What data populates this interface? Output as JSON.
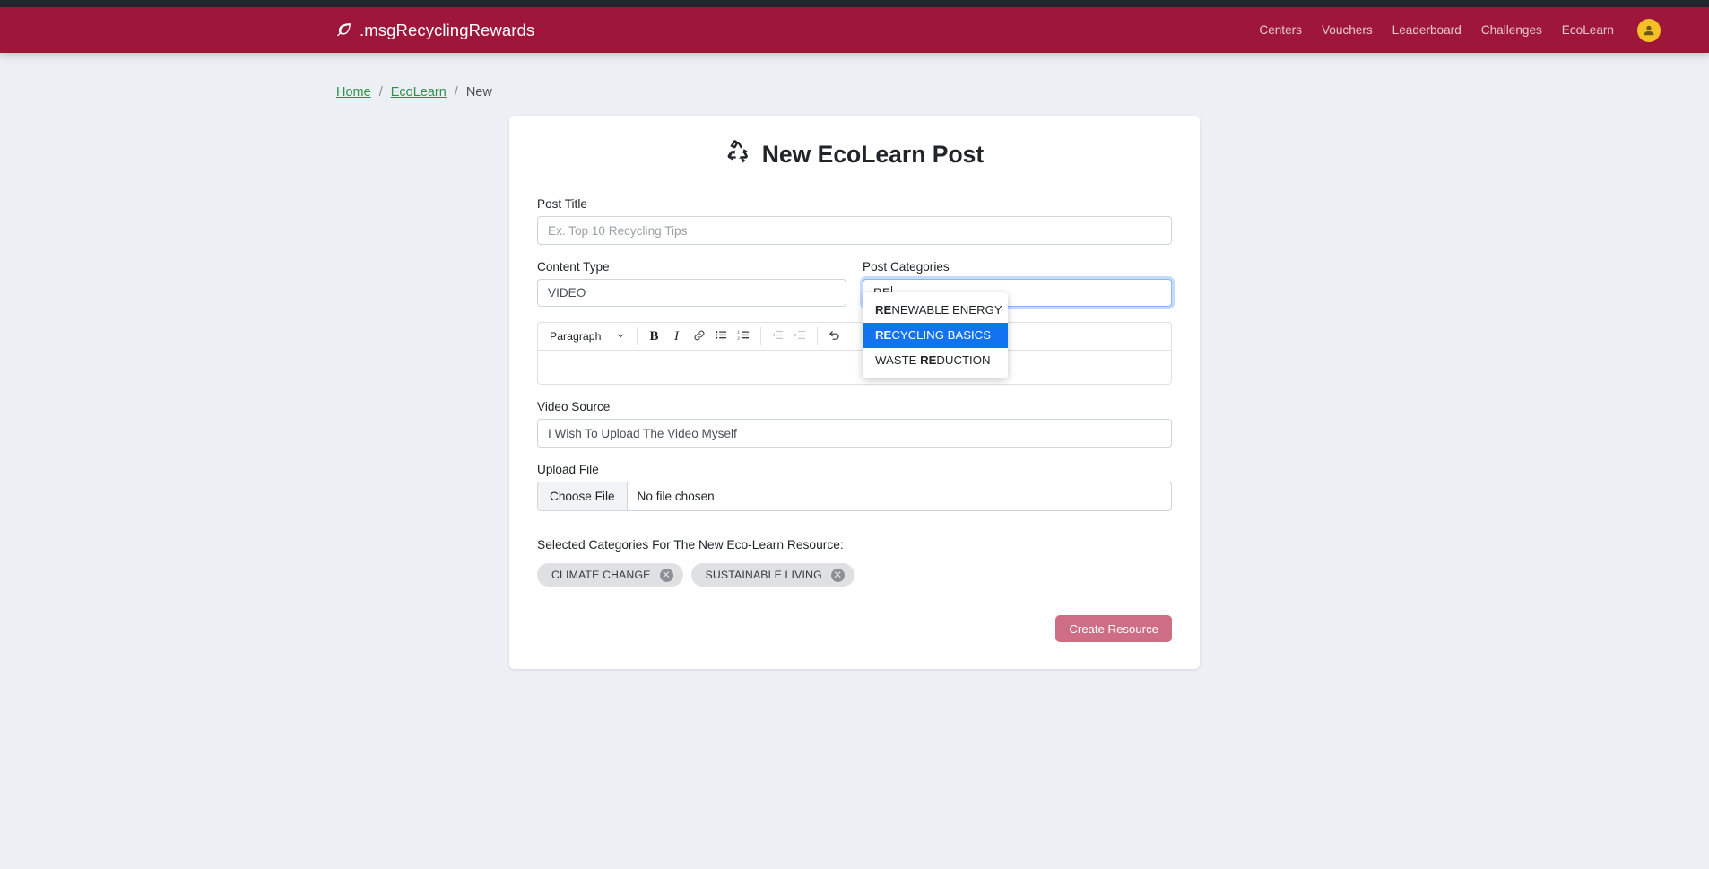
{
  "navbar": {
    "brand": ".msgRecyclingRewards",
    "brand_icon": "leaf-icon",
    "links": [
      {
        "label": "Centers",
        "name": "nav-link-centers"
      },
      {
        "label": "Vouchers",
        "name": "nav-link-vouchers"
      },
      {
        "label": "Leaderboard",
        "name": "nav-link-leaderboard"
      },
      {
        "label": "Challenges",
        "name": "nav-link-challenges"
      },
      {
        "label": "EcoLearn",
        "name": "nav-link-ecolearn"
      }
    ],
    "avatar_icon": "user-avatar-icon",
    "brand_color": "#9e1639",
    "avatar_color": "#f6c026"
  },
  "breadcrumb": {
    "home": "Home",
    "sep1": "/",
    "ecolearn": "EcoLearn",
    "sep2": "/",
    "current": "New",
    "link_color": "#2f8f4e"
  },
  "card": {
    "title": "New EcoLearn Post",
    "title_icon": "recycling-icon"
  },
  "form": {
    "post_title": {
      "label": "Post Title",
      "placeholder": "Ex. Top 10 Recycling Tips",
      "value": ""
    },
    "content_type": {
      "label": "Content Type",
      "value": "VIDEO"
    },
    "post_categories": {
      "label": "Post Categories",
      "value": "RE",
      "focused": true
    },
    "video_source": {
      "label": "Video Source",
      "value": "I Wish To Upload The Video Myself"
    },
    "upload_file": {
      "label": "Upload File",
      "button_label": "Choose File",
      "status": "No file chosen"
    }
  },
  "autocomplete": {
    "highlight_color": "#1273f0",
    "options": [
      {
        "match": "RE",
        "rest": "NEWABLE ENERGY",
        "prefix": "",
        "active": false,
        "full": "RENEWABLE ENERGY"
      },
      {
        "match": "RE",
        "rest": "CYCLING BASICS",
        "prefix": "",
        "active": true,
        "full": "RECYCLING BASICS"
      },
      {
        "match": "RE",
        "rest": "DUCTION",
        "prefix": "WASTE ",
        "active": false,
        "full": "WASTE REDUCTION"
      }
    ]
  },
  "editor": {
    "block_format": "Paragraph",
    "content": "",
    "toolbar": [
      {
        "name": "bold-button",
        "icon": "bold-icon",
        "glyph": "B",
        "style": "bold",
        "disabled": false
      },
      {
        "name": "italic-button",
        "icon": "italic-icon",
        "glyph": "I",
        "style": "italic",
        "disabled": false
      },
      {
        "name": "link-button",
        "icon": "link-icon",
        "glyph": "link",
        "style": "svg",
        "disabled": false
      },
      {
        "name": "bullet-list-button",
        "icon": "bullet-list-icon",
        "glyph": "ul",
        "style": "svg",
        "disabled": false
      },
      {
        "name": "numbered-list-button",
        "icon": "numbered-list-icon",
        "glyph": "ol",
        "style": "svg",
        "disabled": false
      },
      {
        "name": "outdent-button",
        "icon": "outdent-icon",
        "glyph": "outdent",
        "style": "svg",
        "disabled": true
      },
      {
        "name": "indent-button",
        "icon": "indent-icon",
        "glyph": "indent",
        "style": "svg",
        "disabled": true
      },
      {
        "name": "undo-button",
        "icon": "undo-icon",
        "glyph": "undo",
        "style": "svg",
        "disabled": false
      }
    ]
  },
  "selected_categories": {
    "title": "Selected Categories For The New Eco-Learn Resource:",
    "chips": [
      {
        "label": "CLIMATE CHANGE",
        "remove_icon": "remove-chip-icon"
      },
      {
        "label": "SUSTAINABLE LIVING",
        "remove_icon": "remove-chip-icon"
      }
    ]
  },
  "submit": {
    "label": "Create Resource",
    "color": "#cd6e85"
  }
}
